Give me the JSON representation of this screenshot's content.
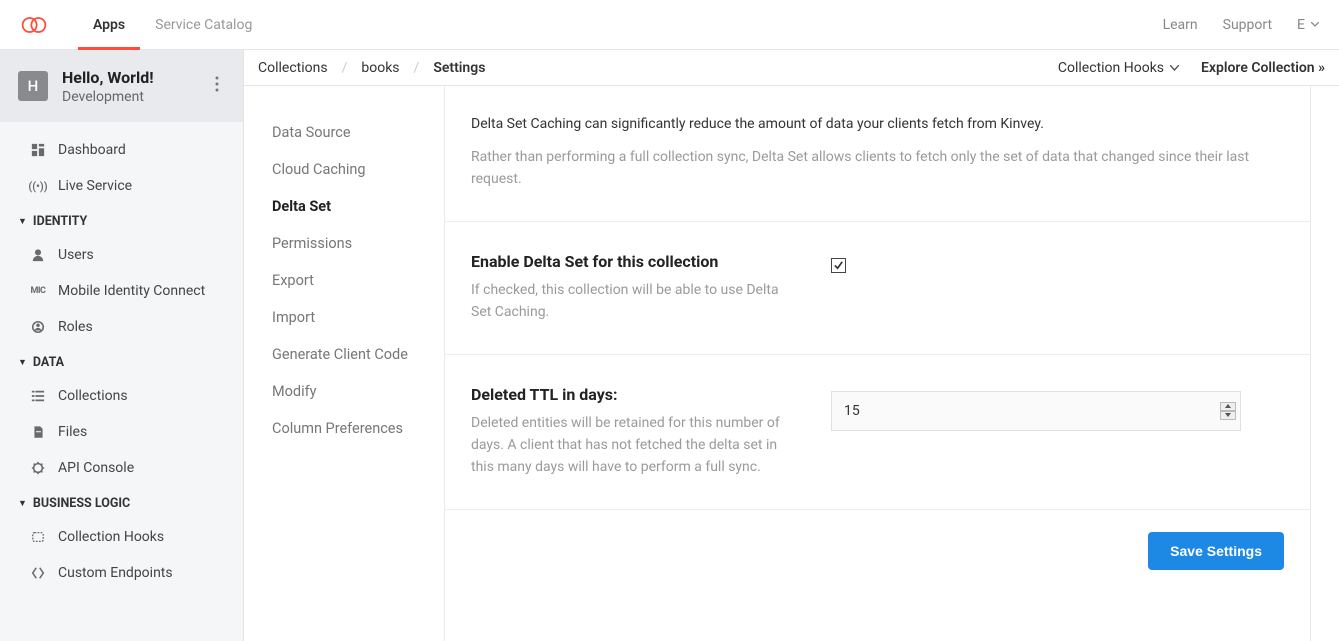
{
  "topnav": {
    "tabs": [
      "Apps",
      "Service Catalog"
    ],
    "right": [
      "Learn",
      "Support",
      "E"
    ]
  },
  "app": {
    "badge": "H",
    "name": "Hello, World!",
    "env": "Development"
  },
  "sidebar": {
    "top": [
      {
        "label": "Dashboard",
        "icon": "dashboard"
      },
      {
        "label": "Live Service",
        "icon": "live"
      }
    ],
    "sections": [
      {
        "title": "IDENTITY",
        "items": [
          {
            "label": "Users",
            "icon": "user"
          },
          {
            "label": "Mobile Identity Connect",
            "icon": "mic"
          },
          {
            "label": "Roles",
            "icon": "role"
          }
        ]
      },
      {
        "title": "DATA",
        "items": [
          {
            "label": "Collections",
            "icon": "list"
          },
          {
            "label": "Files",
            "icon": "file"
          },
          {
            "label": "API Console",
            "icon": "api"
          }
        ]
      },
      {
        "title": "BUSINESS LOGIC",
        "items": [
          {
            "label": "Collection Hooks",
            "icon": "hook"
          },
          {
            "label": "Custom Endpoints",
            "icon": "endpoint"
          }
        ]
      }
    ]
  },
  "breadcrumb": [
    "Collections",
    "books",
    "Settings"
  ],
  "headerActions": {
    "hooks": "Collection Hooks",
    "explore": "Explore Collection »"
  },
  "settingsNav": [
    "Data Source",
    "Cloud Caching",
    "Delta Set",
    "Permissions",
    "Export",
    "Import",
    "Generate Client Code",
    "Modify",
    "Column Preferences"
  ],
  "settingsActive": "Delta Set",
  "panel": {
    "intro1": "Delta Set Caching can significantly reduce the amount of data your clients fetch from Kinvey.",
    "intro2": "Rather than performing a full collection sync, Delta Set allows clients to fetch only the set of data that changed since their last request.",
    "enable": {
      "title": "Enable Delta Set for this collection",
      "desc": "If checked, this collection will be able to use Delta Set Caching.",
      "checked": true
    },
    "ttl": {
      "title": "Deleted TTL in days:",
      "desc": "Deleted entities will be retained for this number of days. A client that has not fetched the delta set in this many days will have to perform a full sync.",
      "value": "15"
    },
    "saveLabel": "Save Settings"
  }
}
